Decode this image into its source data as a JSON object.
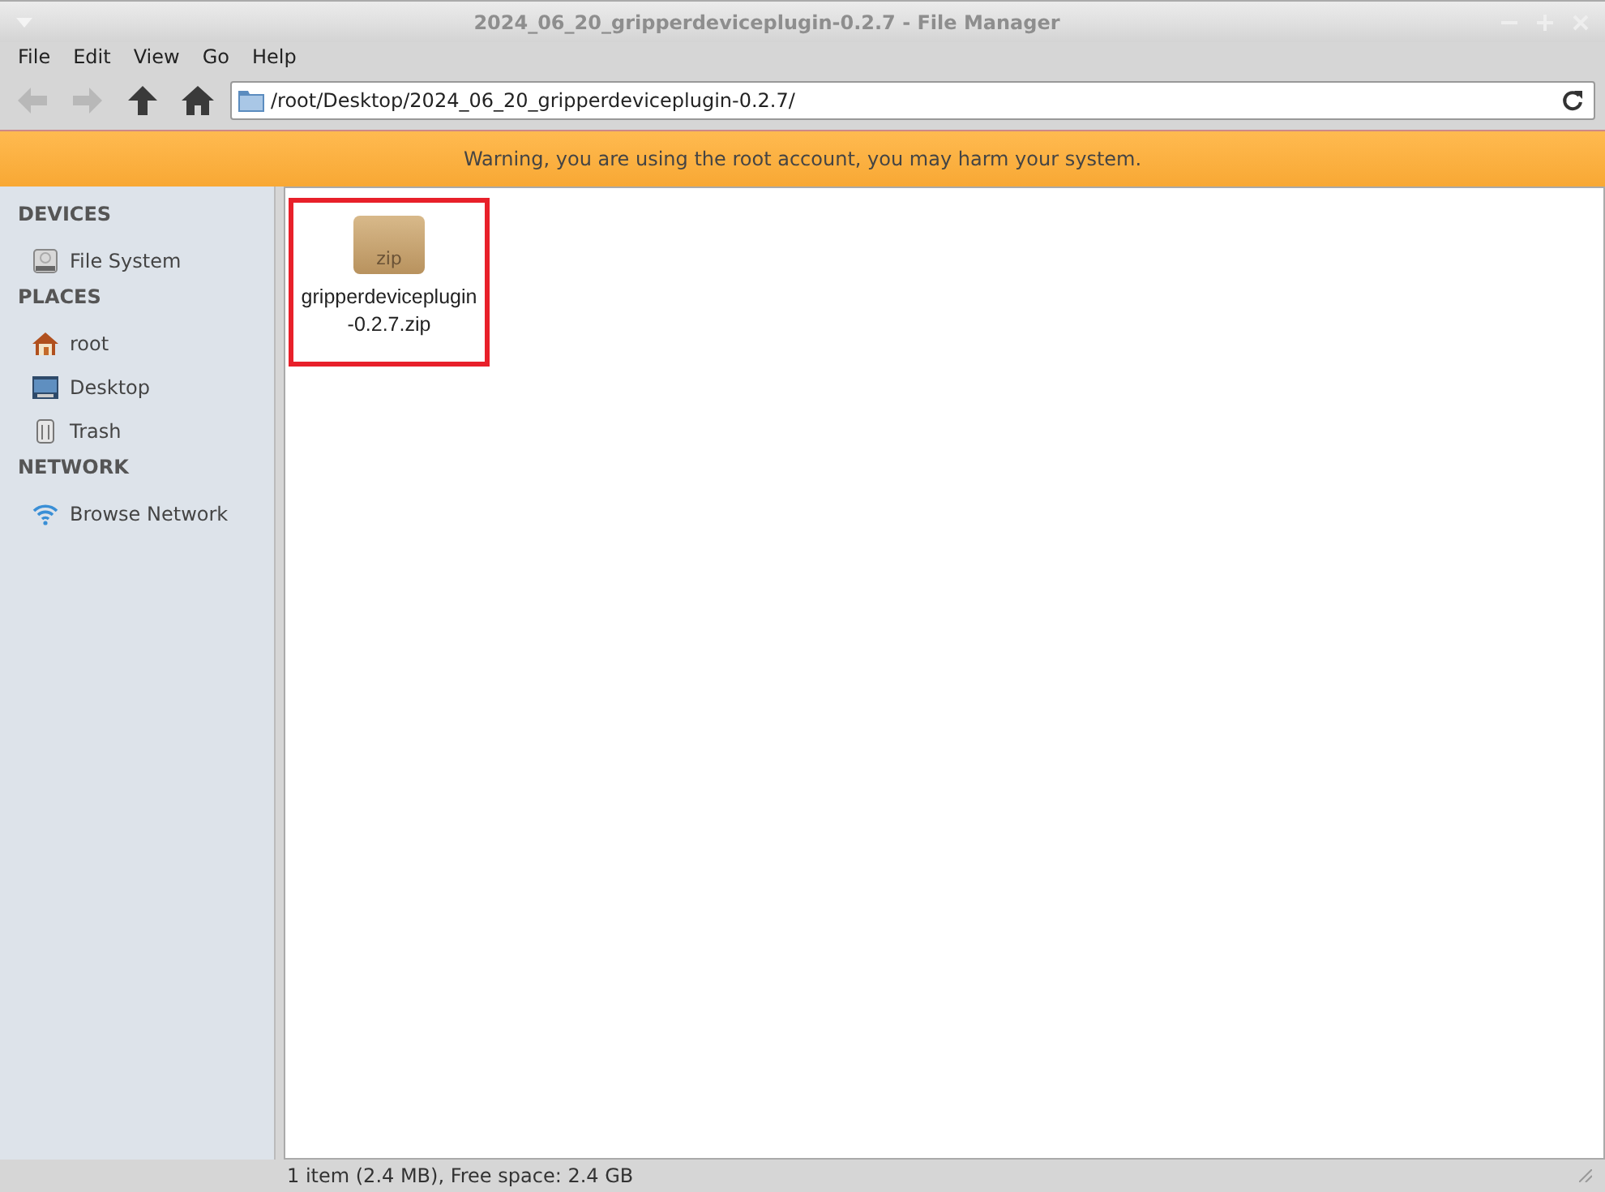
{
  "window": {
    "title": "2024_06_20_gripperdeviceplugin-0.2.7 - File Manager"
  },
  "menu": [
    "File",
    "Edit",
    "View",
    "Go",
    "Help"
  ],
  "toolbar": [
    {
      "kind": "back",
      "disabled": true
    },
    {
      "kind": "forward",
      "disabled": true
    },
    {
      "kind": "up",
      "disabled": false
    },
    {
      "kind": "home",
      "disabled": false
    }
  ],
  "location": {
    "value": "/root/Desktop/2024_06_20_gripperdeviceplugin-0.2.7/"
  },
  "warning": "Warning, you are using the root account, you may harm your system.",
  "sidebar": {
    "sections": [
      {
        "title": "DEVICES",
        "items": [
          {
            "label": "File System",
            "kind": "drive"
          }
        ]
      },
      {
        "title": "PLACES",
        "items": [
          {
            "label": "root",
            "kind": "home"
          },
          {
            "label": "Desktop",
            "kind": "desktop"
          },
          {
            "label": "Trash",
            "kind": "trash"
          }
        ]
      },
      {
        "title": "NETWORK",
        "items": [
          {
            "label": "Browse Network",
            "kind": "network"
          }
        ]
      }
    ]
  },
  "files": [
    {
      "name": "gripperdeviceplugin-0.2.7.zip",
      "icon_label": "zip",
      "highlighted": true
    }
  ],
  "status_bar": "1 item (2.4 MB), Free space: 2.4 GB"
}
